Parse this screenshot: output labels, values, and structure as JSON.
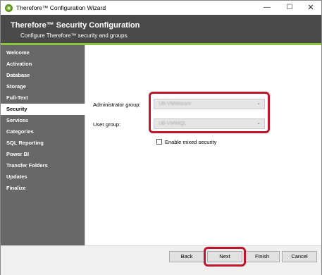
{
  "window": {
    "title": "Therefore™ Configuration Wizard",
    "controls": {
      "minimize": "—",
      "maximize": "☐",
      "close": "✕"
    }
  },
  "header": {
    "title": "Therefore™ Security Configuration",
    "subtitle": "Configure Therefore™ security and groups."
  },
  "sidebar": {
    "items": [
      {
        "label": "Welcome"
      },
      {
        "label": "Activation"
      },
      {
        "label": "Database"
      },
      {
        "label": "Storage"
      },
      {
        "label": "Full-Text"
      },
      {
        "label": "Security",
        "active": true
      },
      {
        "label": "Services"
      },
      {
        "label": "Categories"
      },
      {
        "label": "SQL Reporting"
      },
      {
        "label": "Power BI"
      },
      {
        "label": "Transfer Folders"
      },
      {
        "label": "Updates"
      },
      {
        "label": "Finalize"
      }
    ]
  },
  "form": {
    "admin_group_label": "Administrator group:",
    "admin_group_value": "UB-VM\\Wizare",
    "user_group_label": "User group:",
    "user_group_value": "UB-VM\\MQL",
    "mixed_security_label": "Enable mixed security",
    "mixed_security_checked": false
  },
  "footer": {
    "back_label": "Back",
    "next_label": "Next",
    "finish_label": "Finish",
    "cancel_label": "Cancel"
  },
  "colors": {
    "header_bg": "#4a4a4a",
    "accent": "#8cc63f",
    "sidebar_bg": "#676767",
    "highlight": "#c0152b"
  }
}
